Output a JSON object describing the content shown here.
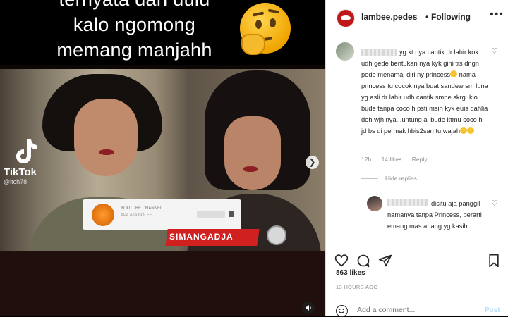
{
  "video": {
    "caption_line1": "ternyata dari dulu",
    "caption_line2": "kalo ngomong",
    "caption_line3": "memang manjahh",
    "emoji_icon": "thinking-face-icon",
    "tiktok_label": "TikTok",
    "tiktok_user": "@itch78",
    "popup_channel": "YOUTUBE CHANNEL",
    "popup_sub": "APA AJA BOLEH",
    "banner_text": "SIMANGADJA"
  },
  "header": {
    "username": "lambee.pedes",
    "dot": "•",
    "follow_status": "Following",
    "more": "•••"
  },
  "comment": {
    "text": "yg kt nya cantik dr lahir kok udh gede bentukan nya kyk gini trs dngn pede menamai diri ny princess",
    "text2": " nama princess tu cocok nya buat sandew sm luna yg asli dr lahir udh cantik smpe skrg..klo bude tanpa coco h psti msih kyk euis dahlia deh wjh nya...untung aj bude ktmu coco h jd bs di permak hbis2san tu wajah",
    "age": "12h",
    "likes": "14 likes",
    "reply": "Reply",
    "hide_replies": "Hide replies"
  },
  "reply": {
    "text": "disitu aja panggil namanya tanpa Princess, berarti emang mas anang yg kasih."
  },
  "actions": {
    "likes": "863 likes",
    "time": "13 HOURS AGO",
    "add_placeholder": "Add a comment...",
    "post": "Post"
  },
  "colors": {
    "accent": "#0095f6",
    "post_disabled": "#b2dffc",
    "brand": "#c01818"
  }
}
